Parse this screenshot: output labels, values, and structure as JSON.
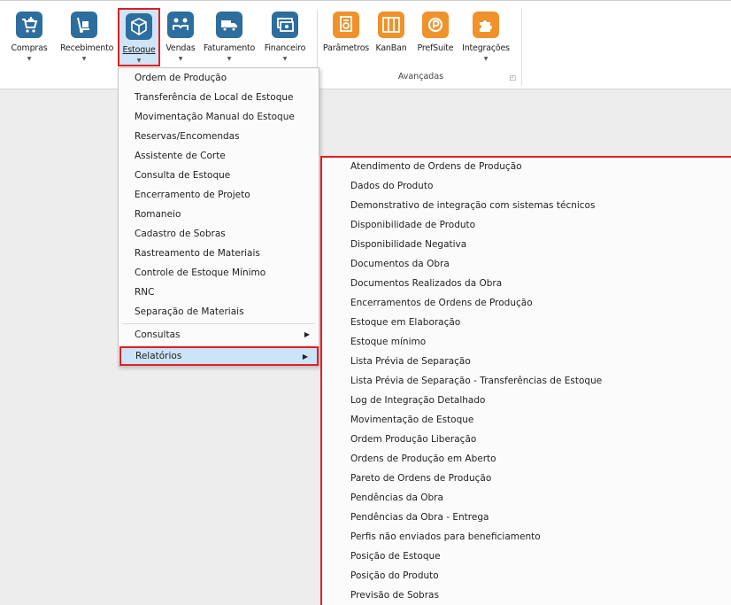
{
  "ribbon": {
    "main_buttons": [
      {
        "label": "Compras",
        "icon": "cart-icon"
      },
      {
        "label": "Recebimento",
        "icon": "hand-truck-icon"
      },
      {
        "label": "Estoque",
        "icon": "boxes-icon"
      },
      {
        "label": "Vendas",
        "icon": "handshake-icon"
      },
      {
        "label": "Faturamento",
        "icon": "truck-icon"
      },
      {
        "label": "Financeiro",
        "icon": "cash-icon"
      }
    ],
    "advanced_buttons": [
      {
        "label": "Parâmetros",
        "icon": "settings-doc-icon"
      },
      {
        "label": "KanBan",
        "icon": "kanban-icon"
      },
      {
        "label": "PrefSuite",
        "icon": "prefsuite-icon"
      },
      {
        "label": "Integrações",
        "icon": "puzzle-icon"
      }
    ],
    "advanced_group_label": "Avançadas",
    "colors": {
      "main_icon": "#2d6e9e",
      "advanced_icon": "#f0922b",
      "highlight": "#e02020"
    }
  },
  "estoque_menu": {
    "items": [
      "Ordem de Produção",
      "Transferência de Local de Estoque",
      "Movimentação Manual do Estoque",
      "Reservas/Encomendas",
      "Assistente de Corte",
      "Consulta de Estoque",
      "Encerramento de Projeto",
      "Romaneio",
      "Cadastro de Sobras",
      "Rastreamento de Materiais",
      "Controle de Estoque Mínimo",
      "RNC",
      "Separação de Materiais"
    ],
    "consultas_label": "Consultas",
    "relatorios_label": "Relatórios"
  },
  "relatorios_submenu": {
    "items": [
      "Atendimento de Ordens de Produção",
      "Dados do Produto",
      "Demonstrativo de integração com sistemas técnicos",
      "Disponibilidade de Produto",
      "Disponibilidade Negativa",
      "Documentos da Obra",
      "Documentos Realizados da Obra",
      "Encerramentos de Ordens de Produção",
      "Estoque em Elaboração",
      "Estoque mínimo",
      "Lista Prévia de Separação",
      "Lista Prévia de Separação - Transferências de Estoque",
      "Log de Integração Detalhado",
      "Movimentação de Estoque",
      "Ordem Produção Liberação",
      "Ordens de Produção em Aberto",
      "Pareto de Ordens de Produção",
      "Pendências da Obra",
      "Pendências da Obra - Entrega",
      "Perfis não enviados para beneficiamento",
      "Posição de Estoque",
      "Posição do Produto",
      "Previsão de Sobras"
    ]
  }
}
